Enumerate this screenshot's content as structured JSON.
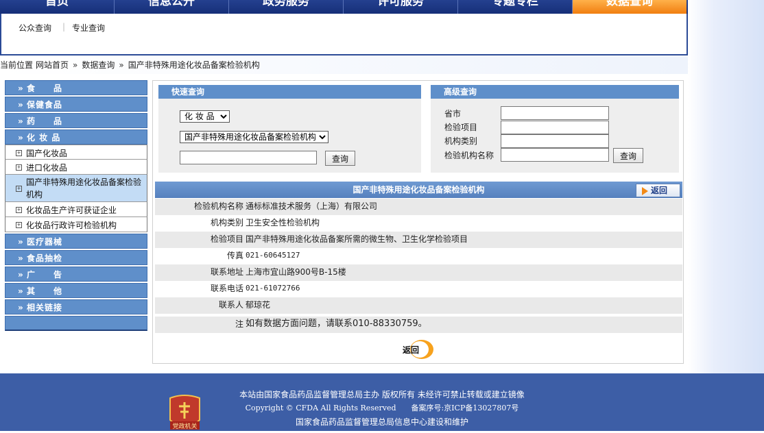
{
  "nav": {
    "items": [
      "首页",
      "信息公开",
      "政务服务",
      "许可服务",
      "专题专栏",
      "数据查询"
    ],
    "active_index": 5
  },
  "subnav": {
    "public_query": "公众查询",
    "pro_query": "专业查询"
  },
  "breadcrumb": {
    "prefix": "当前位置",
    "items": [
      "网站首页",
      "数据查询",
      "国产非特殊用途化妆品备案检验机构"
    ],
    "separator": "»"
  },
  "sidebar": {
    "arrow": "»",
    "cats_top": [
      "食　　品",
      "保健食品",
      "药　　品",
      "化 妆 品"
    ],
    "subs": [
      "国产化妆品",
      "进口化妆品",
      "国产非特殊用途化妆品备案检验机构",
      "化妆品生产许可获证企业",
      "化妆品行政许可检验机构"
    ],
    "selected_sub": 2,
    "cats_bottom": [
      "医疗器械",
      "食品抽检",
      "广　　告",
      "其　　他",
      "相关链接"
    ]
  },
  "quick": {
    "title": "快速查询",
    "category_value": "化 妆 品",
    "type_value": "国产非特殊用途化妆品备案检验机构",
    "keyword_placeholder": "",
    "button": "查询"
  },
  "advanced": {
    "title": "高级查询",
    "labels": [
      "省市",
      "检验项目",
      "机构类别",
      "检验机构名称"
    ],
    "button": "查询"
  },
  "detail": {
    "title": "国产非特殊用途化妆品备案检验机构",
    "back_small": "返回",
    "rows": [
      {
        "k": "检验机构名称",
        "v": "通标标准技术服务（上海）有限公司"
      },
      {
        "k": "机构类别",
        "v": "卫生安全性检验机构"
      },
      {
        "k": "检验项目",
        "v": "国产非特殊用途化妆品备案所需的微生物、卫生化学检验项目"
      },
      {
        "k": "传真",
        "v": "021-60645127"
      },
      {
        "k": "联系地址",
        "v": "上海市宜山路900号B-15楼"
      },
      {
        "k": "联系电话",
        "v": "021-61072766"
      },
      {
        "k": "联系人",
        "v": "郁琼花"
      }
    ],
    "note_label": "注",
    "note_value": "如有数据方面问题，请联系010-88330759。",
    "back_big": "返回"
  },
  "footer": {
    "line1": "本站由国家食品药品监督管理总局主办 版权所有 未经许可禁止转载或建立镜像",
    "line2": "Copyright © CFDA All Rights Reserved　　备案序号:京ICP备13027807号",
    "line3": "国家食品药品监督管理总局信息中心建设和维护",
    "emblem_text": "党政机关"
  },
  "colors": {
    "nav_bg": "#1c3785",
    "active_tab": "#f08a1c",
    "menu_blue": "#5f8fca",
    "footer_bg": "#3d5ea6"
  }
}
